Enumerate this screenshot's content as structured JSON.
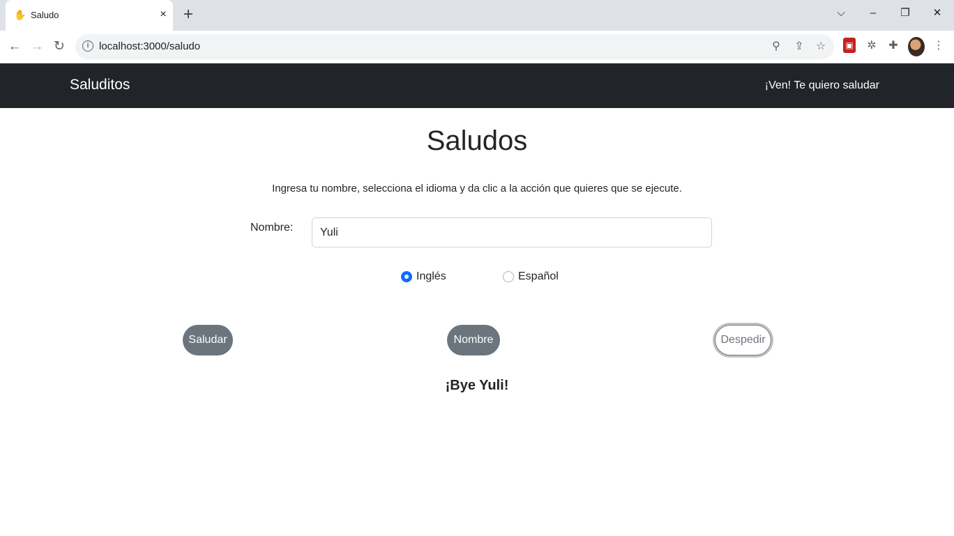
{
  "browser": {
    "tab_title": "Saludo",
    "tab_close": "×",
    "new_tab": "+",
    "url": "localhost:3000/saludo",
    "window_controls": {
      "dropdown": "⌵",
      "minimize": "–",
      "restore": "❐",
      "close": "✕"
    },
    "icons": [
      "back-icon",
      "forward-icon",
      "reload-icon",
      "info-icon",
      "zoom-icon",
      "share-icon",
      "star-icon",
      "extension-red-icon",
      "bug-icon",
      "puzzle-icon",
      "avatar",
      "menu-icon"
    ]
  },
  "navbar": {
    "brand": "Saluditos",
    "link": "¡Ven! Te quiero saludar"
  },
  "main": {
    "title": "Saludos",
    "instructions": "Ingresa tu nombre, selecciona el idioma y da clic a la acción que quieres que se ejecute.",
    "name_label": "Nombre:",
    "name_value": "Yuli",
    "languages": [
      {
        "label": "Inglés",
        "selected": true
      },
      {
        "label": "Español",
        "selected": false
      }
    ],
    "buttons": {
      "greet": "Saludar",
      "name": "Nombre",
      "farewell": "Despedir"
    },
    "result": "¡Bye Yuli!"
  },
  "colors": {
    "navbar_bg": "#212529",
    "button_secondary": "#6c757d",
    "radio_accent": "#0d6efd"
  }
}
